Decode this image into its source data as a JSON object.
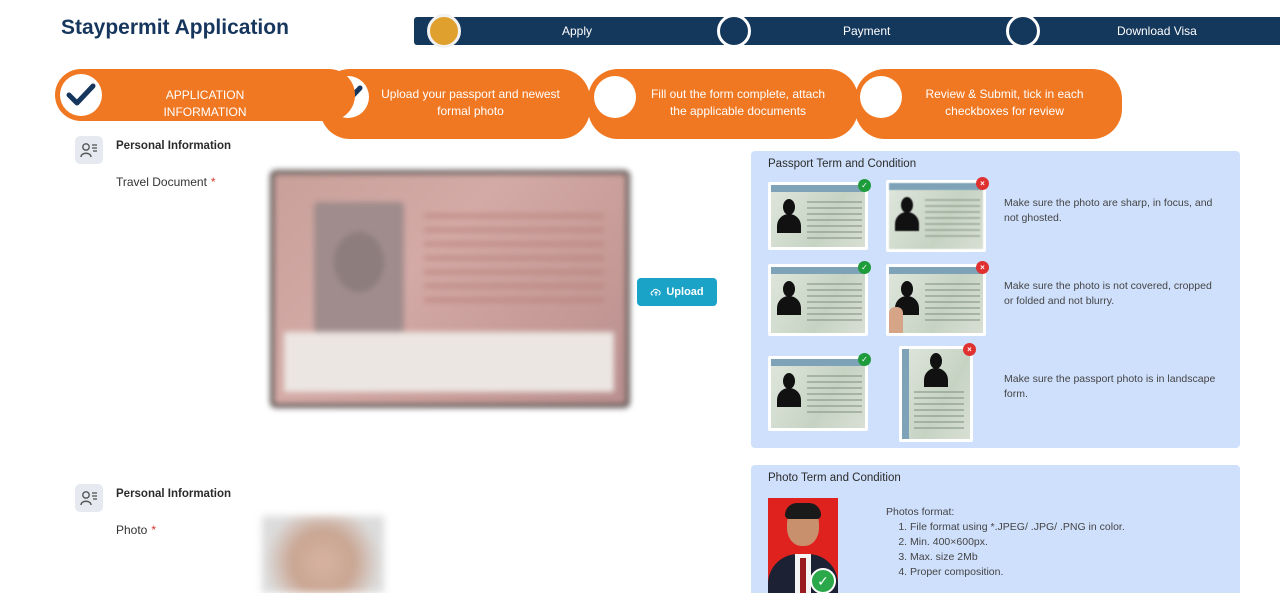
{
  "header": {
    "title": "Staypermit Application"
  },
  "topnav": {
    "steps": [
      {
        "label": "Apply",
        "active": true
      },
      {
        "label": "Payment",
        "active": false
      },
      {
        "label": "Download Visa",
        "active": false
      }
    ],
    "colors": {
      "bar": "#14375c",
      "active": "#e0a02d"
    }
  },
  "stepper": {
    "accent": "#f07822",
    "steps": [
      {
        "label": "APPLICATION INFORMATION",
        "done": true
      },
      {
        "label": "Upload your passport and newest formal photo",
        "done": true
      },
      {
        "label": "Fill out the form complete, attach the applicable documents",
        "done": false
      },
      {
        "label": "Review & Submit, tick in each checkboxes for review",
        "done": false
      }
    ]
  },
  "sections": [
    {
      "title": "Personal Information",
      "field_label": "Travel Document",
      "required_mark": "*"
    },
    {
      "title": "Personal Information",
      "field_label": "Photo",
      "required_mark": "*"
    }
  ],
  "upload_button": {
    "label": "Upload",
    "icon": "cloud-upload-icon"
  },
  "passport_panel": {
    "title": "Passport Term and Condition",
    "rules": [
      {
        "text": "Make sure the photo are sharp, in focus, and not ghosted.",
        "good": "ok",
        "bad": "x"
      },
      {
        "text": "Make sure the photo is not covered, cropped or folded and not blurry.",
        "good": "ok",
        "bad": "x"
      },
      {
        "text": "Make sure the passport photo is in landscape form.",
        "good": "ok",
        "bad": "x"
      }
    ]
  },
  "photo_panel": {
    "title": "Photo Term and Condition",
    "formats_heading": "Photos format:",
    "formats": [
      "File format using *.JPEG/ .JPG/ .PNG in color.",
      "Min. 400×600px.",
      "Max. size 2Mb",
      "Proper composition."
    ]
  }
}
